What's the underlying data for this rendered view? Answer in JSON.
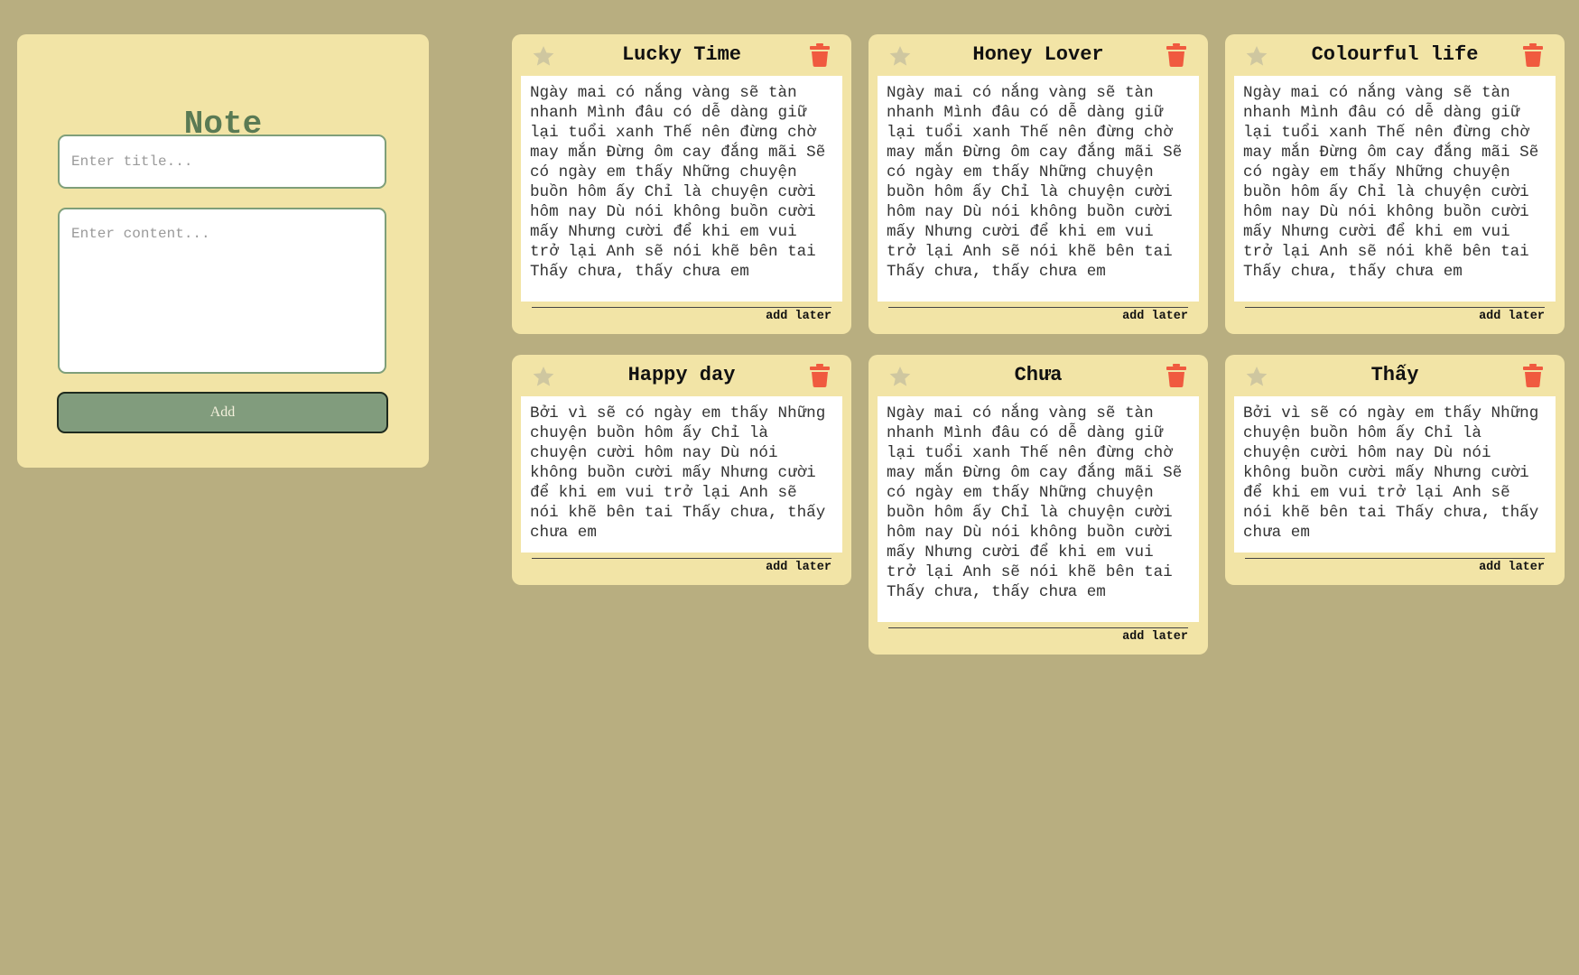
{
  "form": {
    "title": "Note",
    "title_placeholder": "Enter title...",
    "content_placeholder": "Enter content...",
    "add_label": "Add"
  },
  "colors": {
    "background": "#b8ae80",
    "panel": "#f2e4a6",
    "accent_green": "#819c7d",
    "title_green": "#5a7a54",
    "trash_red": "#f05a3f",
    "star_gray": "#cfc7a0"
  },
  "notes": [
    {
      "title": "Lucky Time",
      "content": "Ngày mai có nắng vàng sẽ tàn nhanh Mình đâu có dễ dàng giữ lại tuổi xanh Thế nên đừng chờ may mắn Đừng ôm cay đắng mãi Sẽ có ngày em thấy Những chuyện buồn hôm ấy Chỉ là chuyện cười hôm nay Dù nói không buồn cười mấy Nhưng cười để khi em vui trở lại Anh sẽ nói khẽ bên tai Thấy chưa, thấy chưa em",
      "footer": "add later",
      "star_icon": "star-icon",
      "delete_icon": "trash-icon"
    },
    {
      "title": "Honey Lover",
      "content": "Ngày mai có nắng vàng sẽ tàn nhanh Mình đâu có dễ dàng giữ lại tuổi xanh Thế nên đừng chờ may mắn Đừng ôm cay đắng mãi Sẽ có ngày em thấy Những chuyện buồn hôm ấy Chỉ là chuyện cười hôm nay Dù nói không buồn cười mấy Nhưng cười để khi em vui trở lại Anh sẽ nói khẽ bên tai Thấy chưa, thấy chưa em",
      "footer": "add later",
      "star_icon": "star-icon",
      "delete_icon": "trash-icon"
    },
    {
      "title": "Colourful life",
      "content": "Ngày mai có nắng vàng sẽ tàn nhanh Mình đâu có dễ dàng giữ lại tuổi xanh Thế nên đừng chờ may mắn Đừng ôm cay đắng mãi Sẽ có ngày em thấy Những chuyện buồn hôm ấy Chỉ là chuyện cười hôm nay Dù nói không buồn cười mấy Nhưng cười để khi em vui trở lại Anh sẽ nói khẽ bên tai Thấy chưa, thấy chưa em",
      "footer": "add later",
      "star_icon": "star-icon",
      "delete_icon": "trash-icon"
    },
    {
      "title": "Happy day",
      "content": "Bởi vì sẽ có ngày em thấy Những chuyện buồn hôm ấy Chỉ là chuyện cười hôm nay Dù nói không buồn cười mấy Nhưng cười để khi em vui trở lại Anh sẽ nói khẽ bên tai Thấy chưa, thấy chưa em",
      "footer": "add later",
      "star_icon": "star-icon",
      "delete_icon": "trash-icon"
    },
    {
      "title": "Chưa",
      "content": "Ngày mai có nắng vàng sẽ tàn nhanh Mình đâu có dễ dàng giữ lại tuổi xanh Thế nên đừng chờ may mắn Đừng ôm cay đắng mãi Sẽ có ngày em thấy Những chuyện buồn hôm ấy Chỉ là chuyện cười hôm nay Dù nói không buồn cười mấy Nhưng cười để khi em vui trở lại Anh sẽ nói khẽ bên tai Thấy chưa, thấy chưa em",
      "footer": "add later",
      "star_icon": "star-icon",
      "delete_icon": "trash-icon"
    },
    {
      "title": "Thấy",
      "content": "Bởi vì sẽ có ngày em thấy Những chuyện buồn hôm ấy Chỉ là chuyện cười hôm nay Dù nói không buồn cười mấy Nhưng cười để khi em vui trở lại Anh sẽ nói khẽ bên tai Thấy chưa, thấy chưa em",
      "footer": "add later",
      "star_icon": "star-icon",
      "delete_icon": "trash-icon"
    }
  ]
}
